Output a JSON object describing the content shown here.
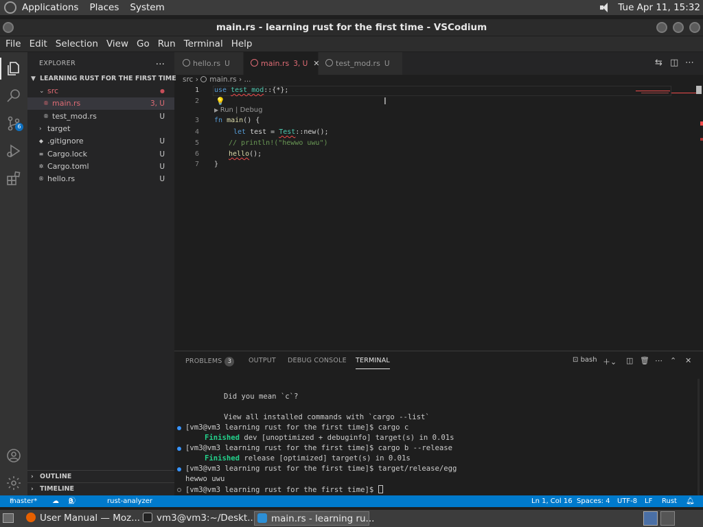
{
  "top_panel": {
    "menus": [
      "Applications",
      "Places",
      "System"
    ],
    "clock": "Tue Apr 11, 15:32"
  },
  "window": {
    "title": "main.rs - learning rust for the first time - VSCodium"
  },
  "menubar": [
    "File",
    "Edit",
    "Selection",
    "View",
    "Go",
    "Run",
    "Terminal",
    "Help"
  ],
  "activity": {
    "scm_badge": "6"
  },
  "sidebar": {
    "title": "EXPLORER",
    "more": "...",
    "root": "LEARNING RUST FOR THE FIRST TIME",
    "items": [
      {
        "label": "src",
        "status": "",
        "color": "#e06c75"
      },
      {
        "label": "main.rs",
        "status": "3, U",
        "color": "#e06c75"
      },
      {
        "label": "test_mod.rs",
        "status": "U",
        "color": "#cccccc"
      },
      {
        "label": "target",
        "status": "",
        "color": "#cccccc"
      },
      {
        "label": ".gitignore",
        "status": "U",
        "color": "#cccccc"
      },
      {
        "label": "Cargo.lock",
        "status": "U",
        "color": "#cccccc"
      },
      {
        "label": "Cargo.toml",
        "status": "U",
        "color": "#cccccc"
      },
      {
        "label": "hello.rs",
        "status": "U",
        "color": "#cccccc"
      }
    ],
    "outline": "OUTLINE",
    "timeline": "TIMELINE"
  },
  "tabs": [
    {
      "label": "hello.rs",
      "status": "U"
    },
    {
      "label": "main.rs",
      "status": "3, U"
    },
    {
      "label": "test_mod.rs",
      "status": "U"
    }
  ],
  "breadcrumb": {
    "folder": "src",
    "file": "main.rs",
    "more": "..."
  },
  "editor": {
    "line_numbers": [
      "1",
      "2",
      "3",
      "4",
      "5",
      "6",
      "7"
    ],
    "codelens": "Run | Debug",
    "lines": {
      "l1_kw": "use",
      "l1_mod": "test_mod",
      "l1_rest": "::{*};",
      "l3_kw": "fn",
      "l3_name": "main",
      "l3_rest": "() {",
      "l4_kw": "let",
      "l4_var": " test = ",
      "l4_type": "Test",
      "l4_rest": "::new();",
      "l5": "// println!(\"hewwo uwu\")",
      "l6_fn": "hello",
      "l6_rest": "();",
      "l7": "}"
    }
  },
  "panel": {
    "tabs": [
      "PROBLEMS",
      "OUTPUT",
      "DEBUG CONSOLE",
      "TERMINAL"
    ],
    "problems_count": "3",
    "shell": "bash",
    "terminal": {
      "l1": "Did you mean `c`?",
      "l2": "View all installed commands with `cargo --list`",
      "l3": "[vm3@vm3 learning rust for the first time]$ cargo c",
      "l4_word": "Finished",
      "l4_rest": " dev [unoptimized + debuginfo] target(s) in 0.01s",
      "l5": "[vm3@vm3 learning rust for the first time]$ cargo b --release",
      "l6_word": "Finished",
      "l6_rest": " release [optimized] target(s) in 0.01s",
      "l7": "[vm3@vm3 learning rust for the first time]$ target/release/egg",
      "l8": "hewwo uwu",
      "l9": "[vm3@vm3 learning rust for the first time]$ "
    }
  },
  "statusbar": {
    "branch": "master*",
    "errors": "3",
    "warnings": "0",
    "lsp": "rust-analyzer",
    "position": "Ln 1, Col 16",
    "spaces": "Spaces: 4",
    "encoding": "UTF-8",
    "eol": "LF",
    "language": "Rust"
  },
  "taskbar": [
    {
      "label": "User Manual — Moz..."
    },
    {
      "label": "vm3@vm3:~/Deskt..."
    },
    {
      "label": "main.rs - learning ru..."
    }
  ],
  "colors": {
    "accent": "#007acc",
    "error": "#f14c4c",
    "modified": "#e06c75"
  }
}
